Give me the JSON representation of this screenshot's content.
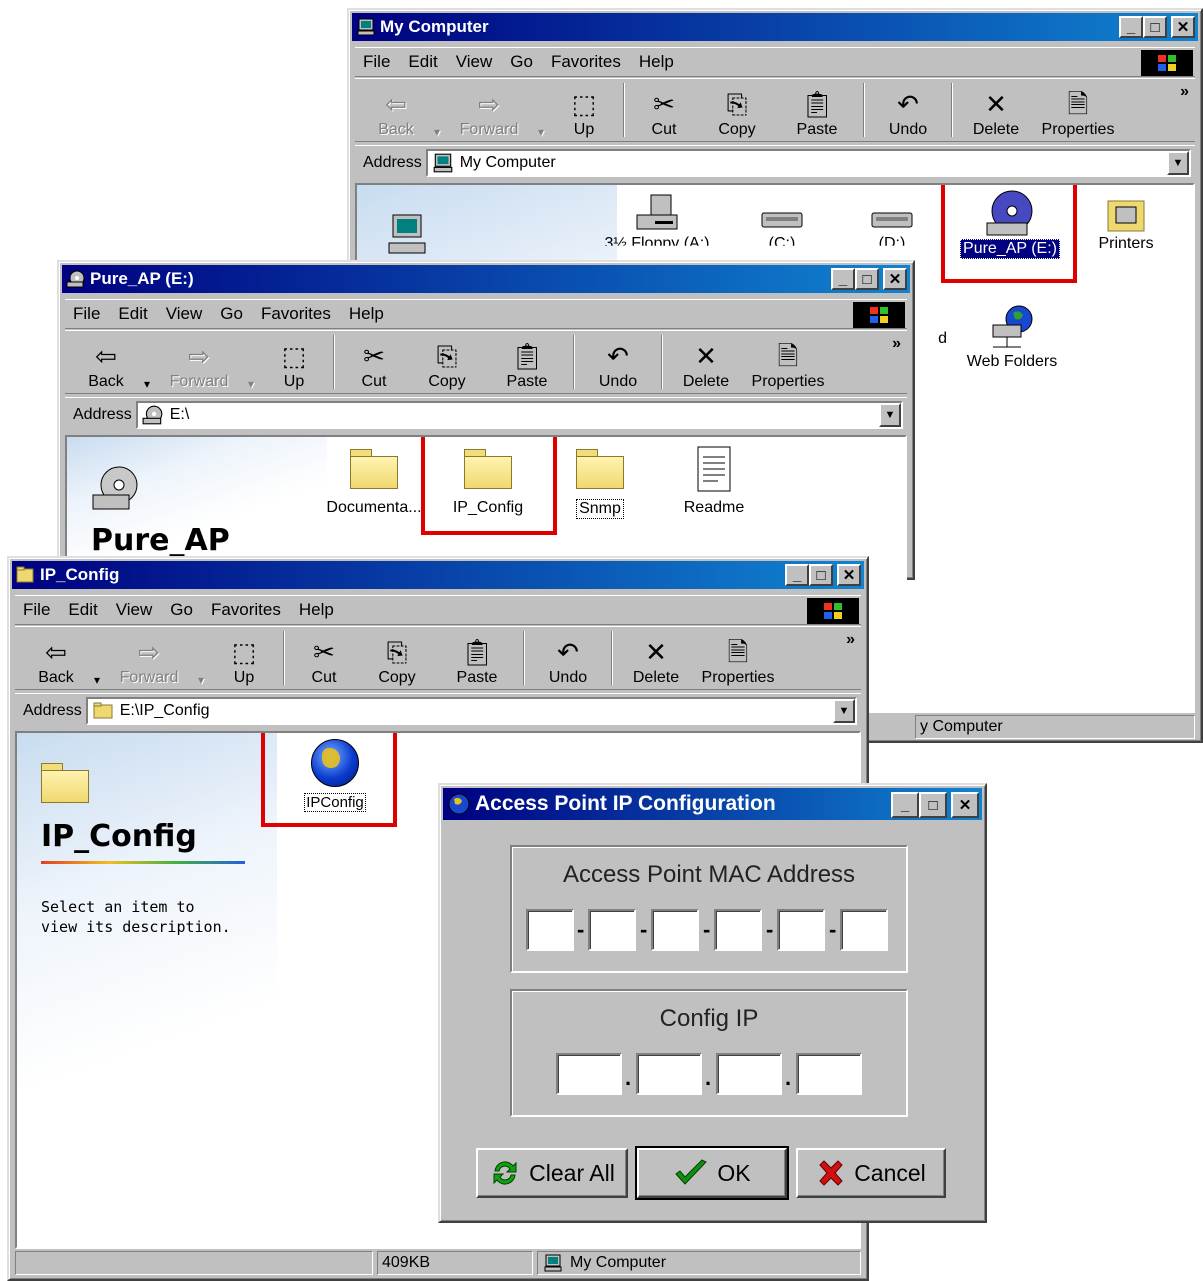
{
  "menu": [
    "File",
    "Edit",
    "View",
    "Go",
    "Favorites",
    "Help"
  ],
  "toolbar": {
    "back": "Back",
    "forward": "Forward",
    "up": "Up",
    "cut": "Cut",
    "copy": "Copy",
    "paste": "Paste",
    "undo": "Undo",
    "delete": "Delete",
    "properties": "Properties",
    "more": "»"
  },
  "address_label": "Address",
  "win_my_computer": {
    "title": "My Computer",
    "address": "My Computer",
    "items": [
      "3½ Floppy (A:)",
      "(C:)",
      "(D:)",
      "Pure_AP (E:)",
      "Printers",
      "d",
      "Web Folders"
    ],
    "status_right": "y Computer"
  },
  "win_pure_ap": {
    "title": "Pure_AP (E:)",
    "address": "E:\\",
    "panel_title": "Pure_AP",
    "items": [
      "Documenta...",
      "IP_Config",
      "Snmp",
      "Readme"
    ]
  },
  "win_ip_config": {
    "title": "IP_Config",
    "address": "E:\\IP_Config",
    "panel_title": "IP_Config",
    "panel_desc_1": "Select an item to",
    "panel_desc_2": "view its description.",
    "items": [
      "IPConfig"
    ],
    "status_size": "409KB",
    "status_location": "My Computer"
  },
  "dialog": {
    "title": "Access Point IP Configuration",
    "mac_group_label": "Access Point MAC Address",
    "ip_group_label": "Config IP",
    "mac_fields": [
      "",
      "",
      "",
      "",
      "",
      ""
    ],
    "ip_fields": [
      "",
      "",
      "",
      ""
    ],
    "clear_all": "Clear All",
    "ok": "OK",
    "cancel": "Cancel"
  },
  "colors": {
    "titlebar_start": "#000080",
    "titlebar_end": "#1084d0",
    "highlight_box": "#e00000",
    "selection": "#000080"
  }
}
